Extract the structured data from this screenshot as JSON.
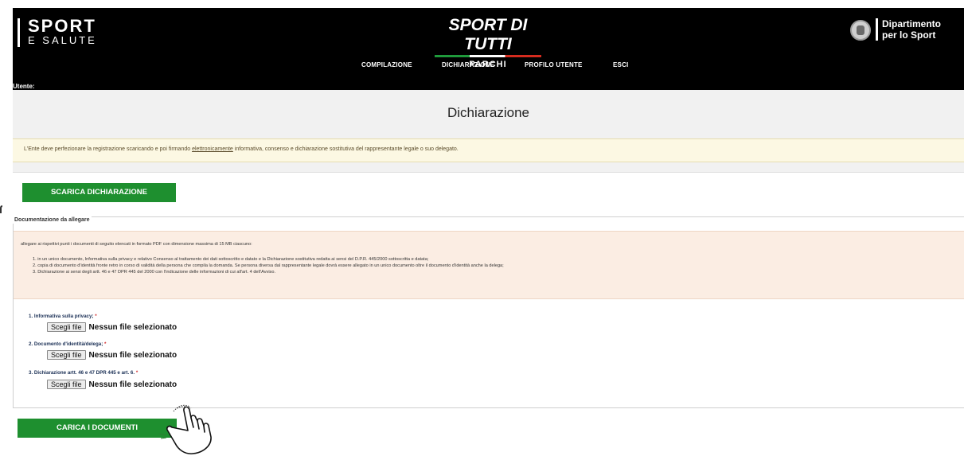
{
  "header": {
    "brand_left_line1": "SPORT",
    "brand_left_line2": "E SALUTE",
    "brand_center_title": "SPORT DI TUTTI",
    "brand_center_subtitle": "PARCHI",
    "brand_right_line1": "Dipartimento",
    "brand_right_line2": "per lo Sport",
    "user_label": "Utente:",
    "nav": [
      "COMPILAZIONE",
      "DICHIARAZIONE",
      "PROFILO UTENTE",
      "ESCI"
    ],
    "flag_colors": [
      "#1f9a3b",
      "#ffffff",
      "#d52b1e"
    ]
  },
  "page": {
    "title": "Dichiarazione",
    "notice_before": "L'Ente deve perfezionare la registrazione scaricando e poi firmando ",
    "notice_link": "elettronicamente",
    "notice_after": " informativa, consenso e dichiarazione sostitutiva del rappresentante legale o suo delegato.",
    "download_button": "SCARICA DICHIARAZIONE",
    "upload_button": "CARICA I DOCUMENTI",
    "accent_color": "#1e8f2f"
  },
  "documentation": {
    "legend": "Documentazione da allegare",
    "intro": "allegare ai rispettivi punti i documenti di seguito elencati in formato PDF con dimensione massima di 15 MB ciascuno:",
    "items": [
      "1. in un unico documento, Informativa sulla privacy e relativo Consenso al trattamento dei dati sottoscritto e datato e la Dichiarazione sostitutiva redatta ai sensi del D.P.R. 445/2000 sottoscritta e datata;",
      "2. copia di documento d'identità fronte retro in corso di validità della persona che compila la domanda. Se persona diversa dal rappresentante legale dovrà essere allegato in un unico documento oltre il documento d'identità anche la delega;",
      "3. Dichiarazione ai sensi degli artt. 46 e 47 DPR 445 del 2000 con l'indicazione delle informazioni di cui all'art. 4 dell'Avviso."
    ]
  },
  "uploads": [
    {
      "label": "1. Informativa sulla privacy;",
      "required_mark": "*",
      "button": "Scegli file",
      "status": "Nessun file selezionato"
    },
    {
      "label": "2. Documento d'identità/delega;",
      "required_mark": "*",
      "button": "Scegli file",
      "status": "Nessun file selezionato"
    },
    {
      "label": "3. Dichiarazione artt. 46 e 47 DPR 445 e art. 6.",
      "required_mark": "*",
      "button": "Scegli file",
      "status": "Nessun file selezionato"
    }
  ]
}
